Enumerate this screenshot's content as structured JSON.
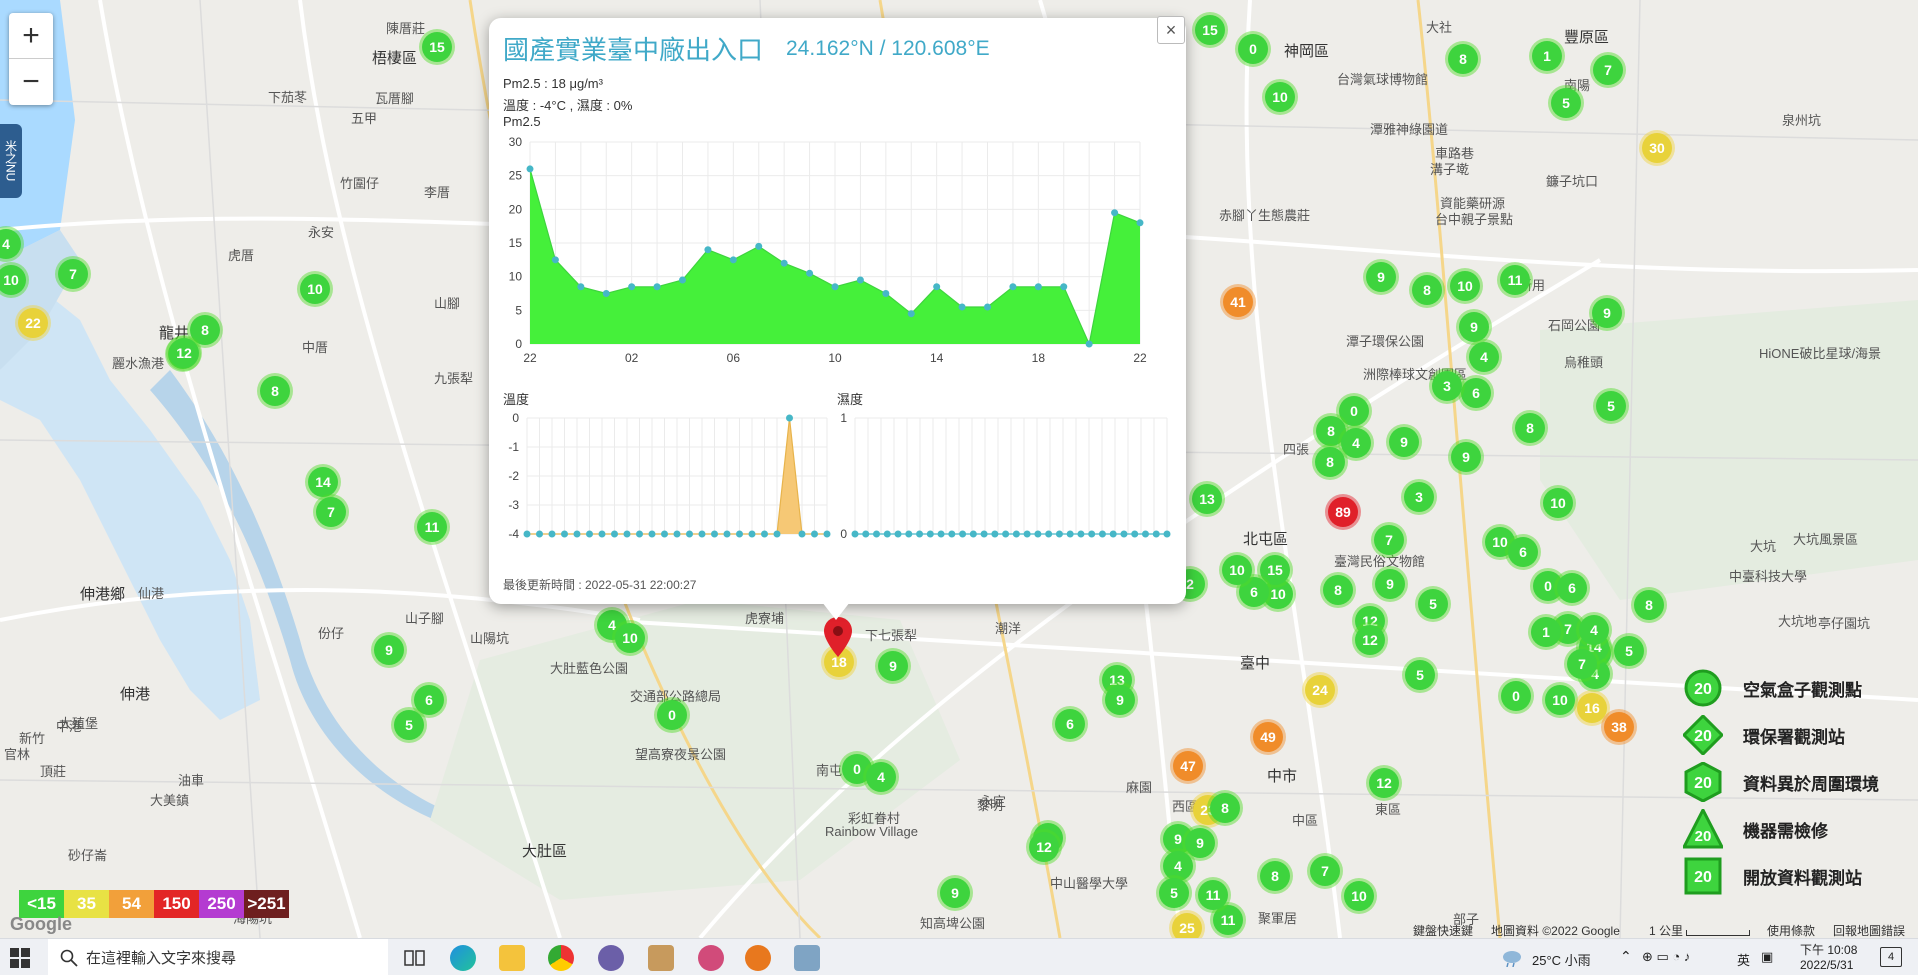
{
  "map": {
    "places": [
      {
        "text": "陳厝莊",
        "big": false
      },
      {
        "text": "梧棲區",
        "big": true
      },
      {
        "text": "下茄苳",
        "big": false
      },
      {
        "text": "瓦厝腳",
        "big": false
      },
      {
        "text": "五甲",
        "big": false
      },
      {
        "text": "竹圍仔",
        "big": false
      },
      {
        "text": "李厝",
        "big": false
      },
      {
        "text": "永安",
        "big": false
      },
      {
        "text": "虎厝",
        "big": false
      },
      {
        "text": "龍井",
        "big": true
      },
      {
        "text": "山腳",
        "big": false
      },
      {
        "text": "中厝",
        "big": false
      },
      {
        "text": "麗水漁港",
        "big": false
      },
      {
        "text": "九張犁",
        "big": false
      },
      {
        "text": "伸港鄉",
        "big": true
      },
      {
        "text": "仙港",
        "big": false
      },
      {
        "text": "伸港",
        "big": true
      },
      {
        "text": "大殖堡",
        "big": false
      },
      {
        "text": "山子腳",
        "big": false
      },
      {
        "text": "山陽坑",
        "big": false
      },
      {
        "text": "份仔",
        "big": false
      },
      {
        "text": "大肚藍色公園",
        "big": false
      },
      {
        "text": "交通部公路總局",
        "big": false
      },
      {
        "text": "望高寮夜景公園",
        "big": false
      },
      {
        "text": "虎寮埔",
        "big": false
      },
      {
        "text": "下七張犁",
        "big": false
      },
      {
        "text": "潮洋",
        "big": false
      },
      {
        "text": "南屯",
        "big": false
      },
      {
        "text": "彩虹眷村",
        "big": false
      },
      {
        "text": "Rainbow Village",
        "big": false
      },
      {
        "text": "大肚區",
        "big": true
      },
      {
        "text": "永定",
        "big": false
      },
      {
        "text": "西區",
        "big": false
      },
      {
        "text": "中區",
        "big": false
      },
      {
        "text": "東區",
        "big": false
      },
      {
        "text": "臺中",
        "big": true
      },
      {
        "text": "中市",
        "big": true
      },
      {
        "text": "北屯區",
        "big": true
      },
      {
        "text": "神岡區",
        "big": true
      },
      {
        "text": "大社",
        "big": false
      },
      {
        "text": "豐原區",
        "big": true
      },
      {
        "text": "南陽",
        "big": false
      },
      {
        "text": "泉州坑",
        "big": false
      },
      {
        "text": "台灣氣球博物館",
        "big": false
      },
      {
        "text": "潭雅神綠園道",
        "big": false
      },
      {
        "text": "車路巷",
        "big": false
      },
      {
        "text": "溝子墘",
        "big": false
      },
      {
        "text": "鐮子坑口",
        "big": false
      },
      {
        "text": "資能藥研源",
        "big": false
      },
      {
        "text": "台中親子景點",
        "big": false
      },
      {
        "text": "赤腳丫生態農莊",
        "big": false
      },
      {
        "text": "上新用",
        "big": false
      },
      {
        "text": "石岡公園",
        "big": false
      },
      {
        "text": "烏稚頭",
        "big": false
      },
      {
        "text": "潭子環保公園",
        "big": false
      },
      {
        "text": "洲際棒球文創園區",
        "big": false
      },
      {
        "text": "四張",
        "big": false
      },
      {
        "text": "臺灣民俗文物館",
        "big": false
      },
      {
        "text": "大坑風景區",
        "big": false
      },
      {
        "text": "中臺科技大學",
        "big": false
      },
      {
        "text": "亭仔園坑",
        "big": false
      },
      {
        "text": "大坑",
        "big": false
      },
      {
        "text": "大坑地",
        "big": false
      },
      {
        "text": "HiONE破比星球/海景",
        "big": false
      },
      {
        "text": "新竹",
        "big": false
      },
      {
        "text": "中港",
        "big": false
      },
      {
        "text": "頂莊",
        "big": false
      },
      {
        "text": "砂仔崙",
        "big": false
      },
      {
        "text": "官林",
        "big": false
      },
      {
        "text": "油車",
        "big": false
      },
      {
        "text": "大美鎮",
        "big": false
      },
      {
        "text": "海陽坑",
        "big": false
      },
      {
        "text": "部子",
        "big": false
      },
      {
        "text": "聚軍居",
        "big": false
      },
      {
        "text": "知高埤公園",
        "big": false
      },
      {
        "text": "中山醫學大學",
        "big": false
      },
      {
        "text": "麻園",
        "big": false
      },
      {
        "text": "黎明",
        "big": false
      }
    ],
    "zoom_in": "+",
    "zoom_out": "−",
    "side_tab": "米之NU"
  },
  "markers": [
    {
      "v": "15"
    },
    {
      "v": "15"
    },
    {
      "v": "0"
    },
    {
      "v": "10"
    },
    {
      "v": "8"
    },
    {
      "v": "1"
    },
    {
      "v": "7"
    },
    {
      "v": "5"
    },
    {
      "v": "4"
    },
    {
      "v": "10"
    },
    {
      "v": "7"
    },
    {
      "v": "22"
    },
    {
      "v": "8"
    },
    {
      "v": "0"
    },
    {
      "v": "12"
    },
    {
      "v": "10"
    },
    {
      "v": "8"
    },
    {
      "v": "14"
    },
    {
      "v": "7"
    },
    {
      "v": "11"
    },
    {
      "v": "9"
    },
    {
      "v": "6"
    },
    {
      "v": "5"
    },
    {
      "v": "4"
    },
    {
      "v": "10"
    },
    {
      "v": "0"
    },
    {
      "v": "18"
    },
    {
      "v": "9"
    },
    {
      "v": "0"
    },
    {
      "v": "4"
    },
    {
      "v": "30"
    },
    {
      "v": "41"
    },
    {
      "v": "9"
    },
    {
      "v": "8"
    },
    {
      "v": "10"
    },
    {
      "v": "11"
    },
    {
      "v": "9"
    },
    {
      "v": "9"
    },
    {
      "v": "4"
    },
    {
      "v": "6"
    },
    {
      "v": "3"
    },
    {
      "v": "5"
    },
    {
      "v": "8"
    },
    {
      "v": "0"
    },
    {
      "v": "8"
    },
    {
      "v": "4"
    },
    {
      "v": "9"
    },
    {
      "v": "9"
    },
    {
      "v": "8"
    },
    {
      "v": "89"
    },
    {
      "v": "3"
    },
    {
      "v": "10"
    },
    {
      "v": "7"
    },
    {
      "v": "10"
    },
    {
      "v": "6"
    },
    {
      "v": "13"
    },
    {
      "v": "2"
    },
    {
      "v": "10"
    },
    {
      "v": "15"
    },
    {
      "v": "6"
    },
    {
      "v": "10"
    },
    {
      "v": "8"
    },
    {
      "v": "9"
    },
    {
      "v": "5"
    },
    {
      "v": "0"
    },
    {
      "v": "6"
    },
    {
      "v": "8"
    },
    {
      "v": "7"
    },
    {
      "v": "9"
    },
    {
      "v": "4"
    },
    {
      "v": "10"
    },
    {
      "v": "14"
    },
    {
      "v": "12"
    },
    {
      "v": "12"
    },
    {
      "v": "5"
    },
    {
      "v": "13"
    },
    {
      "v": "6"
    },
    {
      "v": "9"
    },
    {
      "v": "24"
    },
    {
      "v": "0"
    },
    {
      "v": "16"
    },
    {
      "v": "38"
    },
    {
      "v": "49"
    },
    {
      "v": "47"
    },
    {
      "v": "23"
    },
    {
      "v": "8"
    },
    {
      "v": "12"
    },
    {
      "v": "25"
    },
    {
      "v": "11"
    },
    {
      "v": "7"
    },
    {
      "v": "10"
    },
    {
      "v": "9"
    },
    {
      "v": "9"
    },
    {
      "v": "6"
    },
    {
      "v": "12"
    },
    {
      "v": "4"
    },
    {
      "v": "5"
    },
    {
      "v": "9"
    },
    {
      "v": "11"
    },
    {
      "v": "8"
    },
    {
      "v": "1"
    },
    {
      "v": "7"
    },
    {
      "v": "5"
    },
    {
      "v": "4"
    }
  ],
  "popup": {
    "title": "國產實業臺中廠出入口",
    "coord": "24.162°N / 120.608°E",
    "line1": "Pm2.5 : 18 μg/m³",
    "line2": "溫度 : -4°C , 濕度 : 0%",
    "chart_label": "Pm2.5",
    "temp_label": "溫度",
    "hum_label": "濕度",
    "updated": "最後更新時間 : 2022-05-31 22:00:27",
    "close": "×"
  },
  "chart_data": [
    {
      "type": "area",
      "title": "Pm2.5",
      "x_ticks": [
        "22",
        "02",
        "06",
        "10",
        "14",
        "18",
        "22"
      ],
      "y_ticks": [
        "0",
        "5",
        "10",
        "15",
        "20",
        "25",
        "30"
      ],
      "ylim": [
        0,
        30
      ],
      "values": [
        26,
        12.5,
        8.5,
        7.5,
        8.5,
        8.5,
        9.5,
        14,
        12.5,
        14.5,
        12,
        10.5,
        8.5,
        9.5,
        7.5,
        4.5,
        8.5,
        5.5,
        5.5,
        8.5,
        8.5,
        8.5,
        0,
        19.5,
        18
      ]
    },
    {
      "type": "area",
      "title": "溫度",
      "y_ticks": [
        "0",
        "-1",
        "-2",
        "-3",
        "-4"
      ],
      "ylim": [
        -4,
        0
      ],
      "values": [
        -4,
        -4,
        -4,
        -4,
        -4,
        -4,
        -4,
        -4,
        -4,
        -4,
        -4,
        -4,
        -4,
        -4,
        -4,
        -4,
        -4,
        -4,
        -4,
        -4,
        -4,
        0,
        -4,
        -4,
        -4
      ]
    },
    {
      "type": "line",
      "title": "濕度",
      "y_ticks": [
        "1",
        "0"
      ],
      "ylim": [
        0,
        1
      ],
      "values": [
        0,
        0,
        0,
        0,
        0,
        0,
        0,
        0,
        0,
        0,
        0,
        0,
        0,
        0,
        0,
        0,
        0,
        0,
        0,
        0,
        0,
        0,
        0,
        0,
        0,
        0,
        0,
        0,
        0,
        0
      ]
    }
  ],
  "legend": [
    {
      "label": "空氣盒子觀測點",
      "num": "20",
      "shape": "circle"
    },
    {
      "label": "環保署觀測站",
      "num": "20",
      "shape": "diamond"
    },
    {
      "label": "資料異於周圍環境",
      "num": "20",
      "shape": "hex"
    },
    {
      "label": "機器需檢修",
      "num": "20",
      "shape": "triangle"
    },
    {
      "label": "開放資料觀測站",
      "num": "20",
      "shape": "square"
    }
  ],
  "scale": [
    {
      "label": "<15",
      "color": "#3ed43e"
    },
    {
      "label": "35",
      "color": "#e8e244"
    },
    {
      "label": "54",
      "color": "#f2a03a"
    },
    {
      "label": "150",
      "color": "#e32626"
    },
    {
      "label": "250",
      "color": "#b43bd1"
    },
    {
      "label": ">251",
      "color": "#6e1f1f"
    }
  ],
  "attribution": {
    "google": "Google",
    "shortcuts": "鍵盤快速鍵",
    "mapdata": "地圖資料 ©2022 Google",
    "scale": "1 公里",
    "terms": "使用條款",
    "report": "回報地圖錯誤"
  },
  "taskbar": {
    "search_placeholder": "在這裡輸入文字來搜尋",
    "weather": "25°C 小雨",
    "ime": "英",
    "time": "下午 10:08",
    "date": "2022/5/31",
    "notif": "4"
  },
  "colors": {
    "green": "#3ed43e",
    "yellow": "#e8d23a",
    "orange": "#f08c2a",
    "red": "#e0202a",
    "accent": "#40a9c8"
  }
}
